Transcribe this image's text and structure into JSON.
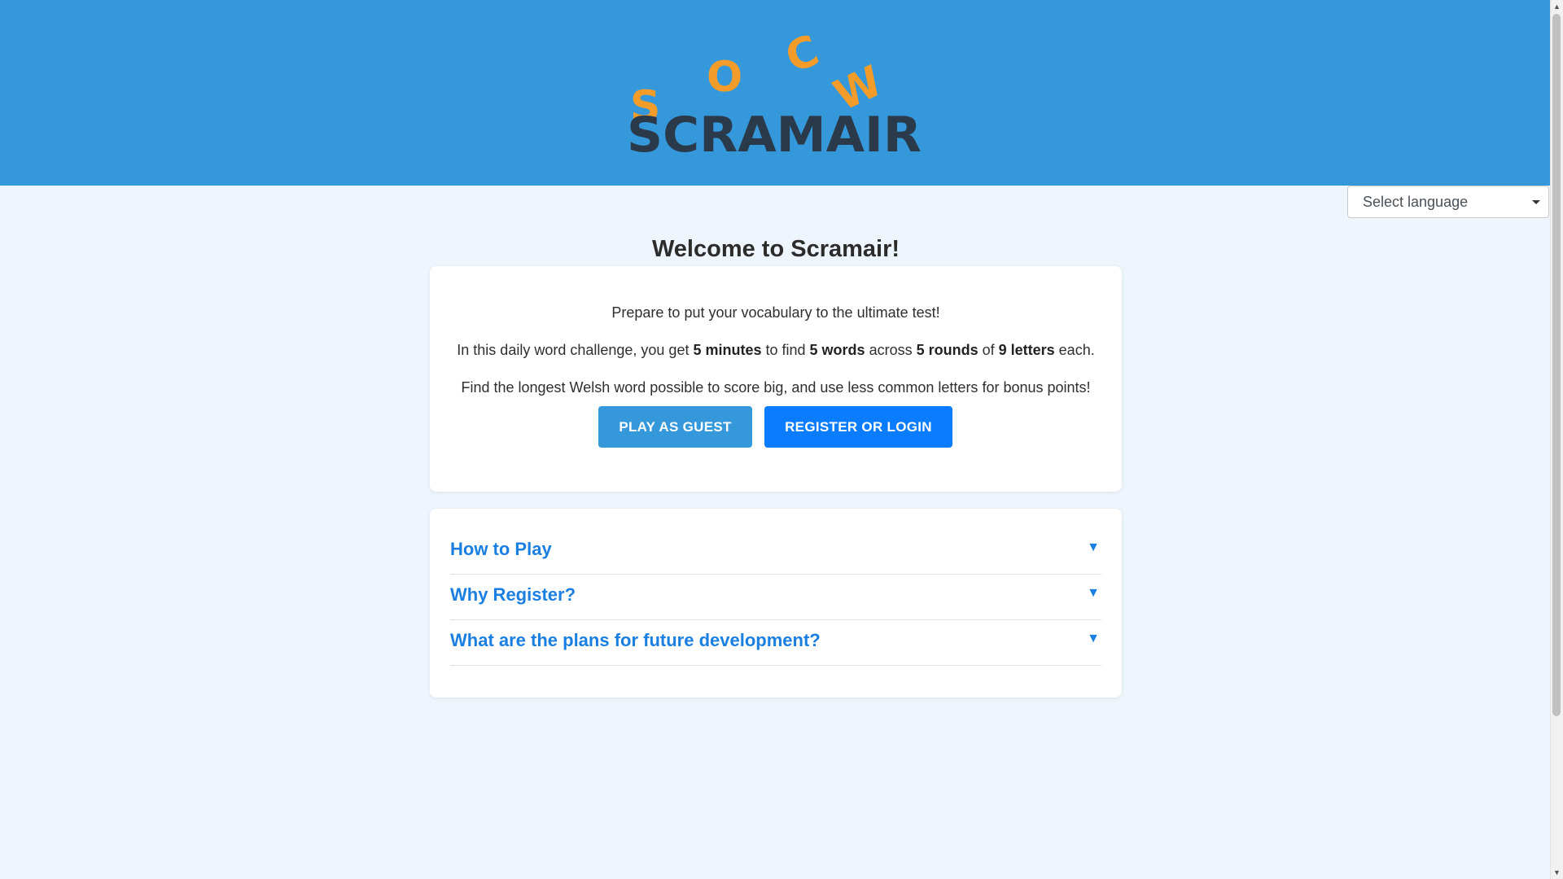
{
  "brand": {
    "logo_text": "SCRAMAIR",
    "floating_letters": [
      "S",
      "O",
      "C",
      "W"
    ],
    "colors": {
      "header_bg": "#3498db",
      "logo_dark": "#2b3a4a",
      "logo_accent": "#f39c2a",
      "primary_button": "#0a7cff",
      "secondary_button": "#3498db",
      "faq_link": "#1a7fe0"
    }
  },
  "language_select": {
    "label": "Select language"
  },
  "welcome": {
    "title": "Welcome to Scramair!"
  },
  "intro": {
    "line1": "Prepare to put your vocabulary to the ultimate test!",
    "line2_parts": {
      "p1": "In this daily word challenge, you get ",
      "b1": "5 minutes",
      "p2": " to find ",
      "b2": "5 words",
      "p3": " across ",
      "b3": "5 rounds",
      "p4": " of ",
      "b4": "9 letters",
      "p5": " each."
    },
    "line3": "Find the longest Welsh word possible to score big, and use less common letters for bonus points!"
  },
  "buttons": {
    "guest": "PLAY AS GUEST",
    "login": "REGISTER OR LOGIN"
  },
  "faq": {
    "items": [
      {
        "title": "How to Play",
        "arrow": "▼"
      },
      {
        "title": "Why Register?",
        "arrow": "▼"
      },
      {
        "title": "What are the plans for future development?",
        "arrow": "▼"
      }
    ]
  }
}
